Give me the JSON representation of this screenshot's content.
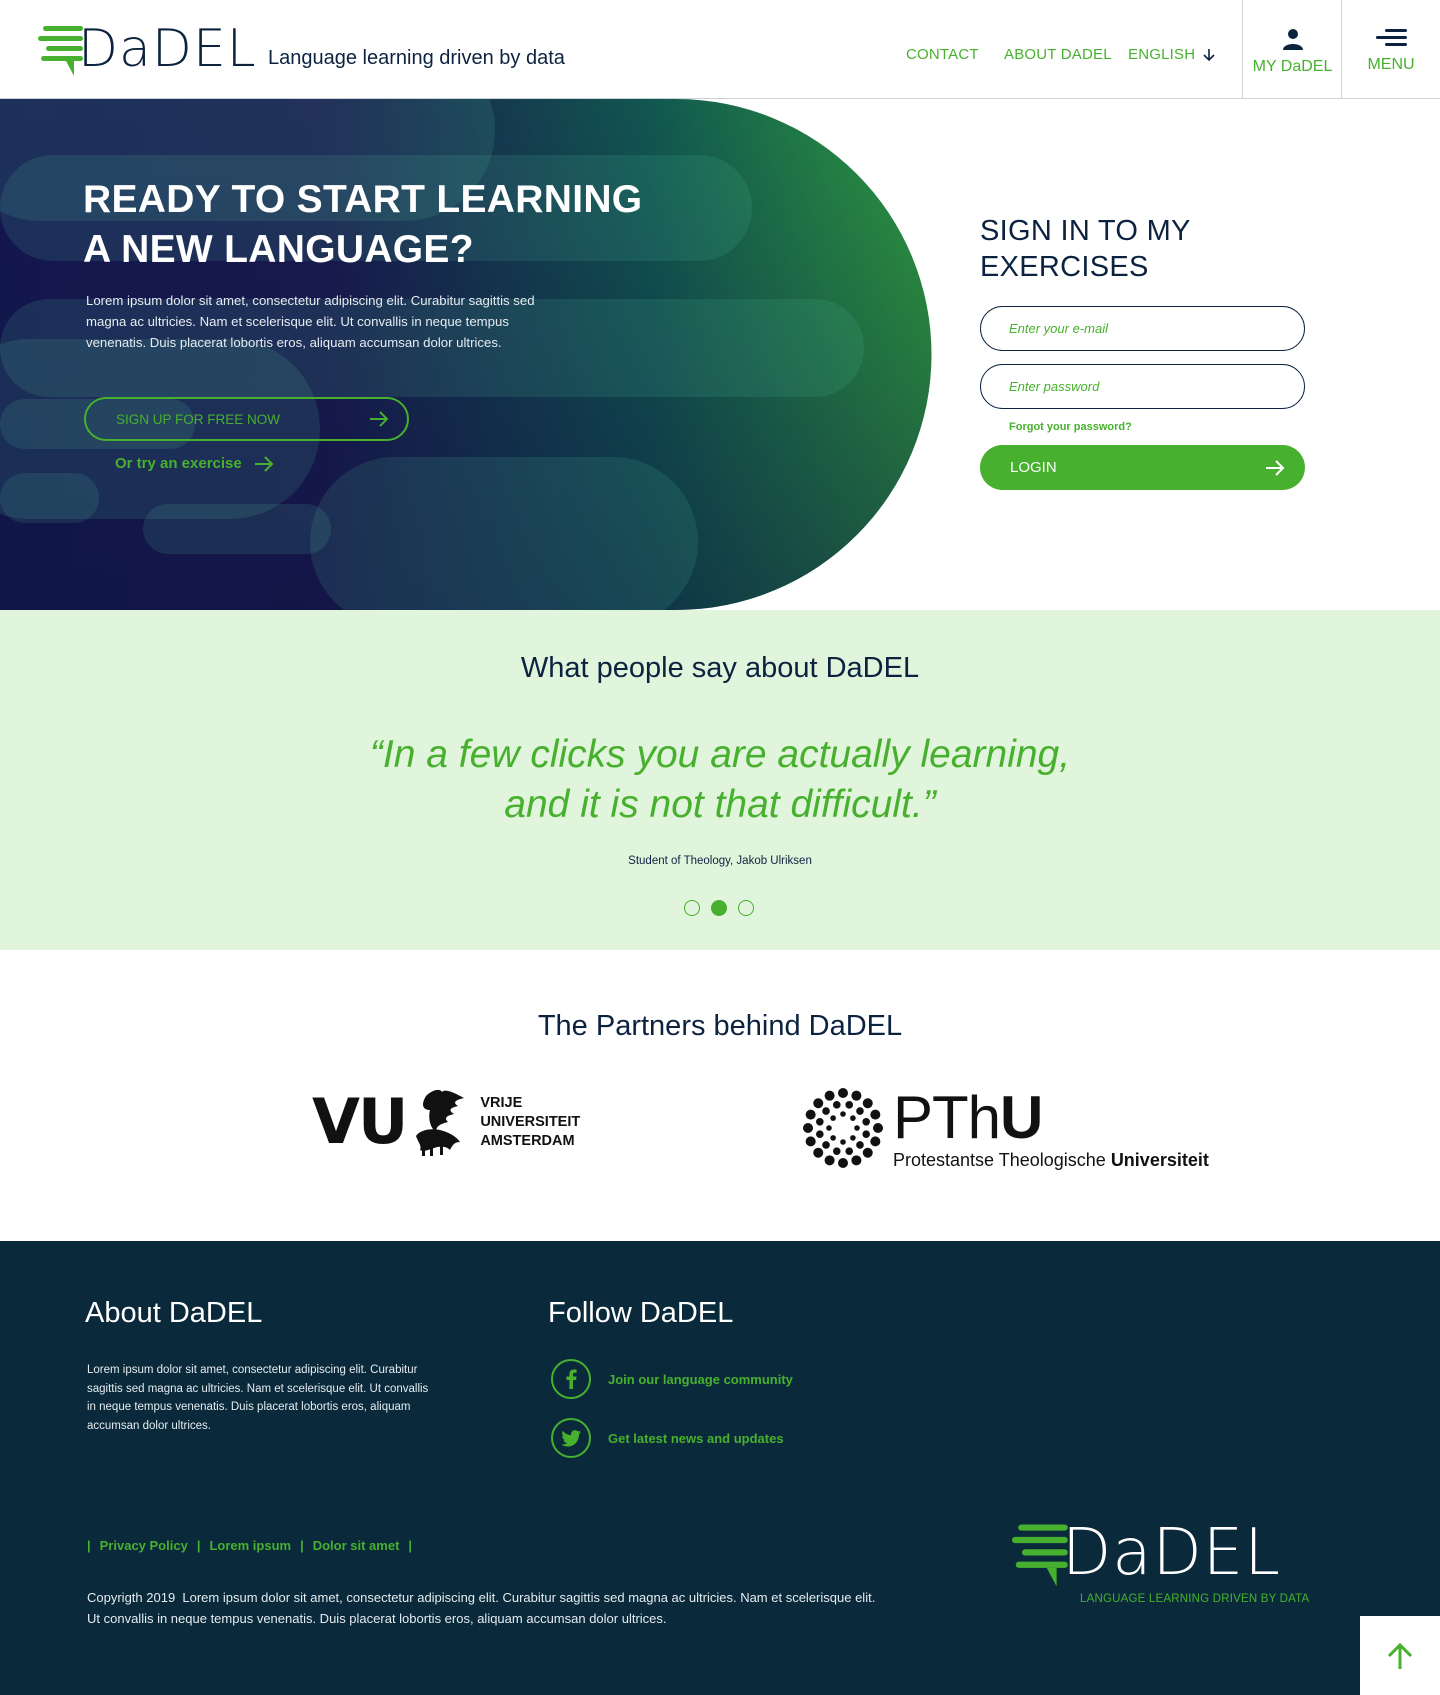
{
  "header": {
    "logo_text": "DaDEL",
    "tagline": "Language learning driven by data",
    "nav": {
      "contact": "CONTACT",
      "about": "ABOUT DADEL",
      "language": "ENGLISH"
    },
    "my_dadel": "MY DaDEL",
    "menu": "MENU"
  },
  "hero": {
    "title_line1": "READY TO START LEARNING",
    "title_line2": "A NEW LANGUAGE?",
    "text": "Lorem ipsum dolor sit amet, consectetur adipiscing elit. Curabitur sagittis sed magna ac ultricies. Nam et scelerisque elit. Ut convallis in neque tempus venenatis. Duis placerat lobortis eros, aliquam accumsan dolor ultrices.",
    "signup_label": "SIGN UP FOR FREE NOW",
    "try_label": "Or try an exercise"
  },
  "signin": {
    "title_line1": "SIGN IN TO MY",
    "title_line2": "EXERCISES",
    "email_placeholder": "Enter your e-mail",
    "password_placeholder": "Enter password",
    "forgot": "Forgot your password?",
    "login_label": "LOGIN"
  },
  "testimonials": {
    "heading": "What people say about DaDEL",
    "quote_line1": "“In a few clicks you are actually learning,",
    "quote_line2": "and it is not that difficult.”",
    "author": "Student of Theology, Jakob Ulriksen",
    "active_slide": 2,
    "slide_count": 3
  },
  "partners": {
    "heading": "The Partners behind DaDEL",
    "vu": {
      "abbr": "VU",
      "line1": "VRIJE",
      "line2": "UNIVERSITEIT",
      "line3": "AMSTERDAM"
    },
    "pthu": {
      "name_part1": "PTh",
      "name_part2": "U",
      "sub_part1": "Protestantse Theologische ",
      "sub_part2": "Universiteit"
    }
  },
  "footer": {
    "about_heading": "About DaDEL",
    "about_text": "Lorem ipsum dolor sit amet, consectetur adipiscing elit. Curabitur sagittis sed magna ac ultricies. Nam et scelerisque elit. Ut convallis in neque tempus venenatis. Duis placerat lobortis eros, aliquam accumsan dolor ultrices.",
    "follow_heading": "Follow DaDEL",
    "facebook_label": "Join our language community",
    "twitter_label": "Get latest news and updates",
    "separator": "|",
    "links": [
      "Privacy Policy",
      "Lorem ipsum",
      "Dolor sit amet"
    ],
    "copyright_line1": "Copyrigth 2019  Lorem ipsum dolor sit amet, consectetur adipiscing elit. Curabitur sagittis sed magna ac ultricies. Nam et scelerisque elit.",
    "copyright_line2": "Ut convallis in neque tempus venenatis. Duis placerat lobortis eros, aliquam accumsan dolor ultrices.",
    "logo_text": "DaDEL",
    "logo_tagline": "LANGUAGE LEARNING DRIVEN BY DATA"
  },
  "icons": {
    "arrow_right": "arrow-right-icon",
    "arrow_down": "arrow-down-icon",
    "arrow_up": "arrow-up-icon",
    "user": "user-icon",
    "menu": "hamburger-icon",
    "facebook": "facebook-icon",
    "twitter": "twitter-icon"
  },
  "colors": {
    "navy": "#0c2340",
    "green": "#47b02e",
    "light_green": "#e1f4dc",
    "footer_bg": "#0a2a3b"
  }
}
